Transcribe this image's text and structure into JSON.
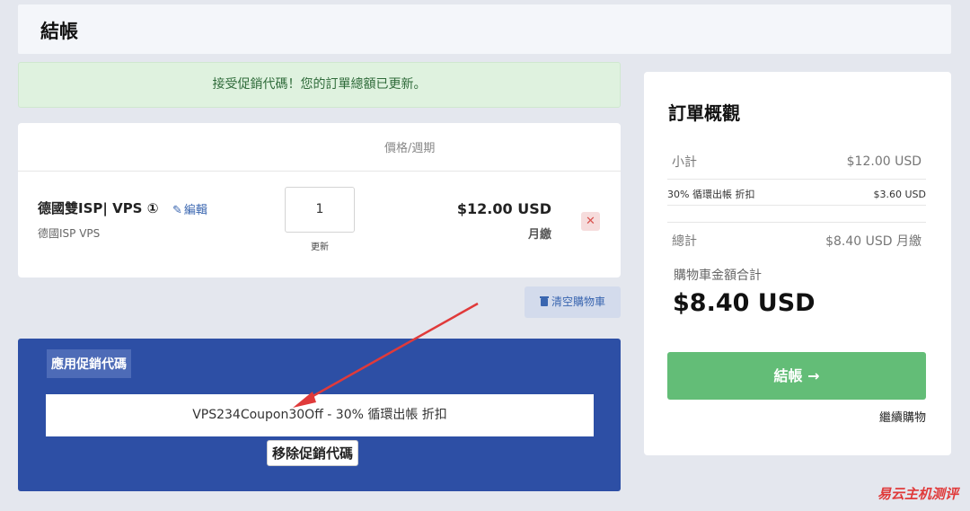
{
  "header": {
    "title": "結帳"
  },
  "alert": {
    "message": "接受促銷代碼！您的訂單總額已更新。"
  },
  "cart": {
    "column_header": "價格/週期",
    "item": {
      "name": "德國雙ISP| VPS ①",
      "edit_label": "編輯",
      "subtitle": "德國ISP VPS",
      "quantity": "1",
      "update_label": "更新",
      "price": "$12.00 USD",
      "cycle": "月繳",
      "remove_icon": "✕"
    },
    "empty_label": "清空購物車"
  },
  "promo": {
    "title": "應用促銷代碼",
    "code_text": "VPS234Coupon30Off - 30% 循環出帳 折扣",
    "remove_label": "移除促銷代碼"
  },
  "summary": {
    "title": "訂單概觀",
    "subtotal_label": "小計",
    "subtotal_value": "$12.00 USD",
    "discount_label": "30% 循環出帳 折扣",
    "discount_value": "$3.60 USD",
    "total_label": "總計",
    "total_value": "$8.40 USD 月繳",
    "cart_total_label": "購物車金額合計",
    "cart_total_value": "$8.40 USD",
    "checkout_label": "結帳 →",
    "continue_label": "繼續購物"
  },
  "watermark": "易云主机测评",
  "colors": {
    "promo_bg": "#2d4fa5",
    "checkout_green": "#63bd77",
    "alert_bg": "#dff2df",
    "annotation_red": "#e03a3a"
  },
  "icons": [
    "pencil-icon",
    "remove-x-icon",
    "trash-icon",
    "arrow-right-icon",
    "annotation-arrow"
  ]
}
